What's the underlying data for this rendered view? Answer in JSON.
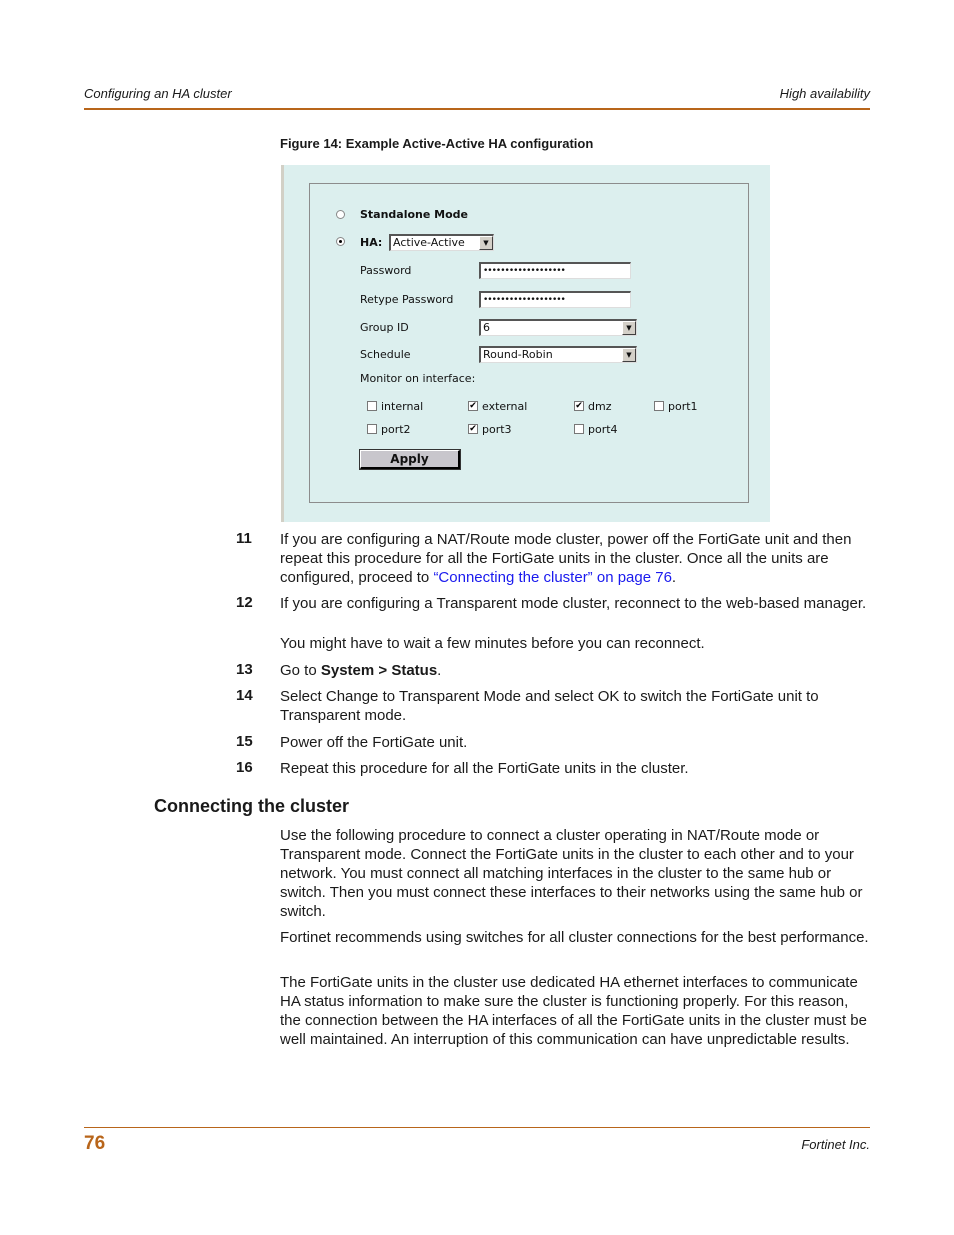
{
  "header": {
    "left": "Configuring an HA cluster",
    "right": "High availability"
  },
  "figure": {
    "caption": "Figure 14: Example Active-Active HA configuration",
    "form": {
      "standalone_label": "Standalone Mode",
      "standalone_selected": false,
      "ha_label": "HA:",
      "ha_selected": true,
      "ha_mode_value": "Active-Active",
      "password_label": "Password",
      "password_value": "•••••••••••••••••••",
      "retype_label": "Retype Password",
      "retype_value": "•••••••••••••••••••",
      "group_id_label": "Group ID",
      "group_id_value": "6",
      "schedule_label": "Schedule",
      "schedule_value": "Round-Robin",
      "monitor_label": "Monitor on interface:",
      "interfaces": [
        {
          "name": "internal",
          "checked": false
        },
        {
          "name": "external",
          "checked": true
        },
        {
          "name": "dmz",
          "checked": true
        },
        {
          "name": "port1",
          "checked": false
        },
        {
          "name": "port2",
          "checked": false
        },
        {
          "name": "port3",
          "checked": true
        },
        {
          "name": "port4",
          "checked": false
        }
      ],
      "apply_label": "Apply",
      "dropdown_arrow": "▼",
      "check_mark": "✔"
    }
  },
  "steps": [
    {
      "num": "11",
      "text_before": "If you are configuring a NAT/Route mode cluster, power off the FortiGate unit and then repeat this procedure for all the FortiGate units in the cluster. Once all the units are configured, proceed to ",
      "link": "“Connecting the cluster” on page 76",
      "text_after": "."
    },
    {
      "num": "12",
      "text": "If you are configuring a Transparent mode cluster, reconnect to the web-based manager.",
      "note": "You might have to wait a few minutes before you can reconnect."
    },
    {
      "num": "13",
      "text_before": "Go to ",
      "bold": "System > Status",
      "text_after": "."
    },
    {
      "num": "14",
      "text": "Select Change to Transparent Mode and select OK to switch the FortiGate unit to Transparent mode."
    },
    {
      "num": "15",
      "text": "Power off the FortiGate unit."
    },
    {
      "num": "16",
      "text": "Repeat this procedure for all the FortiGate units in the cluster."
    }
  ],
  "section": {
    "title": "Connecting the cluster",
    "paragraphs": [
      "Use the following procedure to connect a cluster operating in NAT/Route mode or Transparent mode. Connect the FortiGate units in the cluster to each other and to your network. You must connect all matching interfaces in the cluster to the same hub or switch. Then you must connect these interfaces to their networks using the same hub or switch.",
      "Fortinet recommends using switches for all cluster connections for the best performance.",
      "The FortiGate units in the cluster use dedicated HA ethernet interfaces to communicate HA status information to make sure the cluster is functioning properly. For this reason, the connection between the HA interfaces of all the FortiGate units in the cluster must be well maintained. An interruption of this communication can have unpredictable results."
    ]
  },
  "footer": {
    "page_number": "76",
    "company": "Fortinet Inc."
  },
  "colors": {
    "accent": "#b8651a",
    "link": "#1a1aee",
    "panel_bg": "#dcefee"
  }
}
